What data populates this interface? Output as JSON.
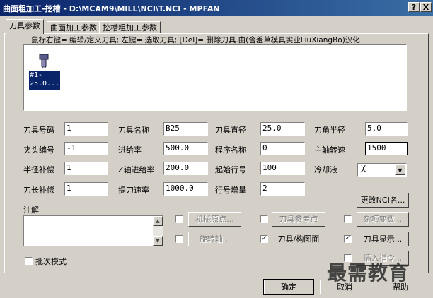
{
  "window": {
    "title": "曲面粗加工-挖槽 - D:\\MCAM9\\MILL\\NCI\\T.NCI - MPFAN",
    "help_btn": "?",
    "close_btn": "X"
  },
  "tabs": [
    {
      "label": "刀具参数",
      "active": true
    },
    {
      "label": "曲面加工参数",
      "active": false
    },
    {
      "label": "挖槽粗加工参数",
      "active": false
    }
  ],
  "hint": "鼠标右键= 编辑/定义刀具; 左键= 选取刀具; [Del]= 删除刀具.由(含羞草模具实业LiuXiangBo)汉化",
  "tool_item": {
    "line1": "#1-",
    "line2": "25.0..."
  },
  "fields": {
    "tool_number": {
      "label": "刀具号码",
      "value": "1"
    },
    "tool_name": {
      "label": "刀具名称",
      "value": "B25"
    },
    "tool_diameter": {
      "label": "刀具直径",
      "value": "25.0"
    },
    "corner_radius": {
      "label": "刀角半径",
      "value": "5.0"
    },
    "holder_number": {
      "label": "夹头编号",
      "value": "-1"
    },
    "feed_rate": {
      "label": "进给率",
      "value": "500.0"
    },
    "program_name": {
      "label": "程序名称",
      "value": "0"
    },
    "spindle_speed": {
      "label": "主轴转速",
      "value": "1500"
    },
    "radius_comp": {
      "label": "半径补偿",
      "value": "1"
    },
    "plunge_rate": {
      "label": "Z轴进给率",
      "value": "200.0"
    },
    "start_line": {
      "label": "起始行号",
      "value": "100"
    },
    "coolant": {
      "label": "冷却液",
      "value": "关"
    },
    "length_comp": {
      "label": "刀长补偿",
      "value": "1"
    },
    "retract_rate": {
      "label": "提刀速率",
      "value": "1000.0"
    },
    "line_increment": {
      "label": "行号增量",
      "value": "2"
    }
  },
  "buttons": {
    "change_nci": "更改NCI名...",
    "machine_origin": "机械原点...",
    "tool_ref_point": "刀具参考点",
    "misc_values": "杂项变数...",
    "rotary_axis": "旋转轴...",
    "tool_plane": "刀具/构图面",
    "tool_display": "刀具显示...",
    "insert_cmd": "插入指令...",
    "ok": "确定",
    "cancel": "取消",
    "help": "帮助"
  },
  "checkboxes": {
    "machine_origin": false,
    "tool_ref_point": false,
    "misc_values": false,
    "rotary_axis": false,
    "tool_plane": true,
    "tool_display": true,
    "insert_cmd": false,
    "batch_mode": false
  },
  "labels": {
    "notes": "注解",
    "batch_mode": "批次模式"
  },
  "watermark": "最需教育"
}
